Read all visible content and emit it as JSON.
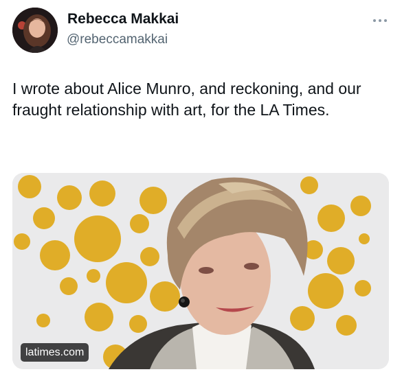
{
  "author": {
    "display_name": "Rebecca Makkai",
    "handle": "@rebeccamakkai",
    "avatar_icon": "author-avatar"
  },
  "tweet": {
    "text": "I wrote about Alice Munro, and reckoning, and our fraught relationship with art, for the LA Times."
  },
  "card": {
    "domain": "latimes.com",
    "image_icon": "article-photo"
  },
  "more_icon": "more-options-icon",
  "colors": {
    "text_primary": "#0f1419",
    "text_secondary": "#536471",
    "dot_yellow": "#e0ad28",
    "card_background": "#e9e9ea"
  }
}
